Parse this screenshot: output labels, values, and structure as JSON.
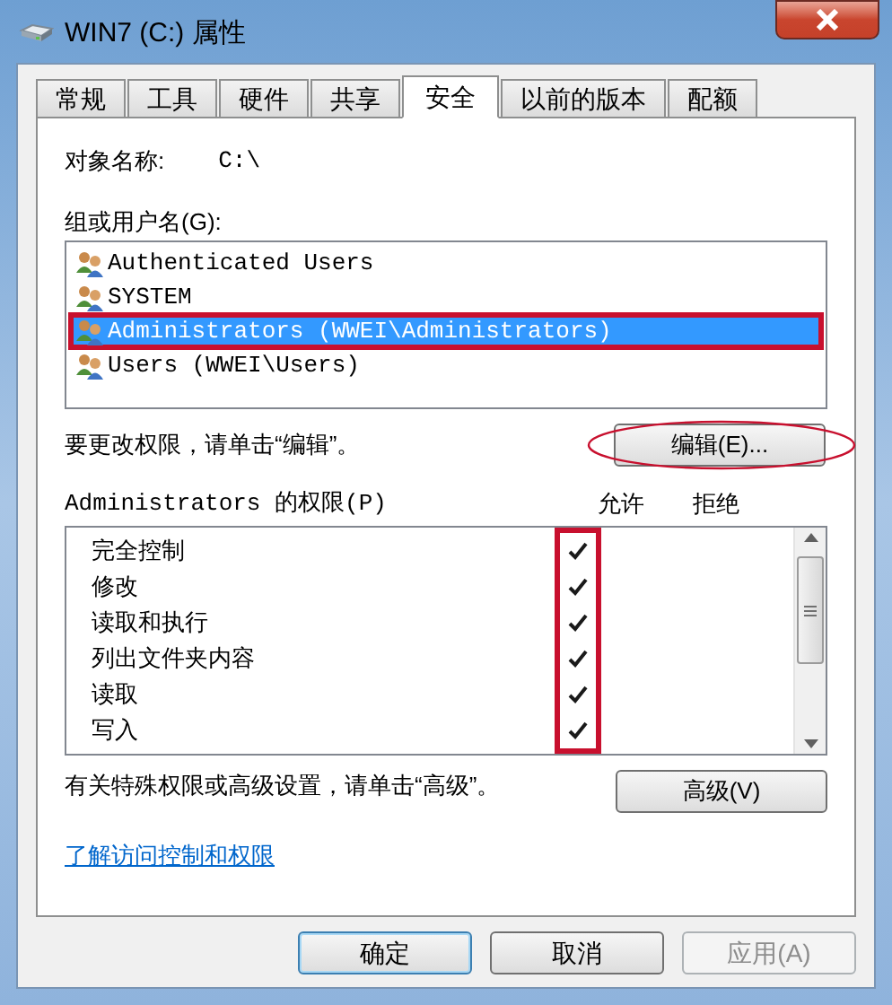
{
  "window": {
    "title": "WIN7 (C:) 属性"
  },
  "tabs": [
    {
      "label": "常规",
      "selected": false
    },
    {
      "label": "工具",
      "selected": false
    },
    {
      "label": "硬件",
      "selected": false
    },
    {
      "label": "共享",
      "selected": false
    },
    {
      "label": "安全",
      "selected": true
    },
    {
      "label": "以前的版本",
      "selected": false
    },
    {
      "label": "配额",
      "selected": false
    }
  ],
  "object_name": {
    "label": "对象名称:",
    "value": "C:\\"
  },
  "users_label": "组或用户名(G):",
  "users": [
    {
      "name": "Authenticated Users",
      "selected": false,
      "annotated": false
    },
    {
      "name": "SYSTEM",
      "selected": false,
      "annotated": false
    },
    {
      "name": "Administrators (WWEI\\Administrators)",
      "selected": true,
      "annotated": true
    },
    {
      "name": "Users (WWEI\\Users)",
      "selected": false,
      "annotated": false
    }
  ],
  "edit_hint": "要更改权限，请单击“编辑”。",
  "edit_button": {
    "label": "编辑(E)...",
    "annotated": true
  },
  "permissions_label": "Administrators 的权限(P)",
  "allow_header": "允许",
  "deny_header": "拒绝",
  "allow_annotated": true,
  "permissions": [
    {
      "name": "完全控制",
      "allow": true,
      "deny": false
    },
    {
      "name": "修改",
      "allow": true,
      "deny": false
    },
    {
      "name": "读取和执行",
      "allow": true,
      "deny": false
    },
    {
      "name": "列出文件夹内容",
      "allow": true,
      "deny": false
    },
    {
      "name": "读取",
      "allow": true,
      "deny": false
    },
    {
      "name": "写入",
      "allow": true,
      "deny": false
    }
  ],
  "advanced_hint": "有关特殊权限或高级设置，请单击“高级”。",
  "advanced_button": "高级(V)",
  "help_link": "了解访问控制和权限",
  "buttons": [
    {
      "label": "确定",
      "default": true,
      "disabled": false
    },
    {
      "label": "取消",
      "default": false,
      "disabled": false
    },
    {
      "label": "应用(A)",
      "default": false,
      "disabled": true
    }
  ]
}
